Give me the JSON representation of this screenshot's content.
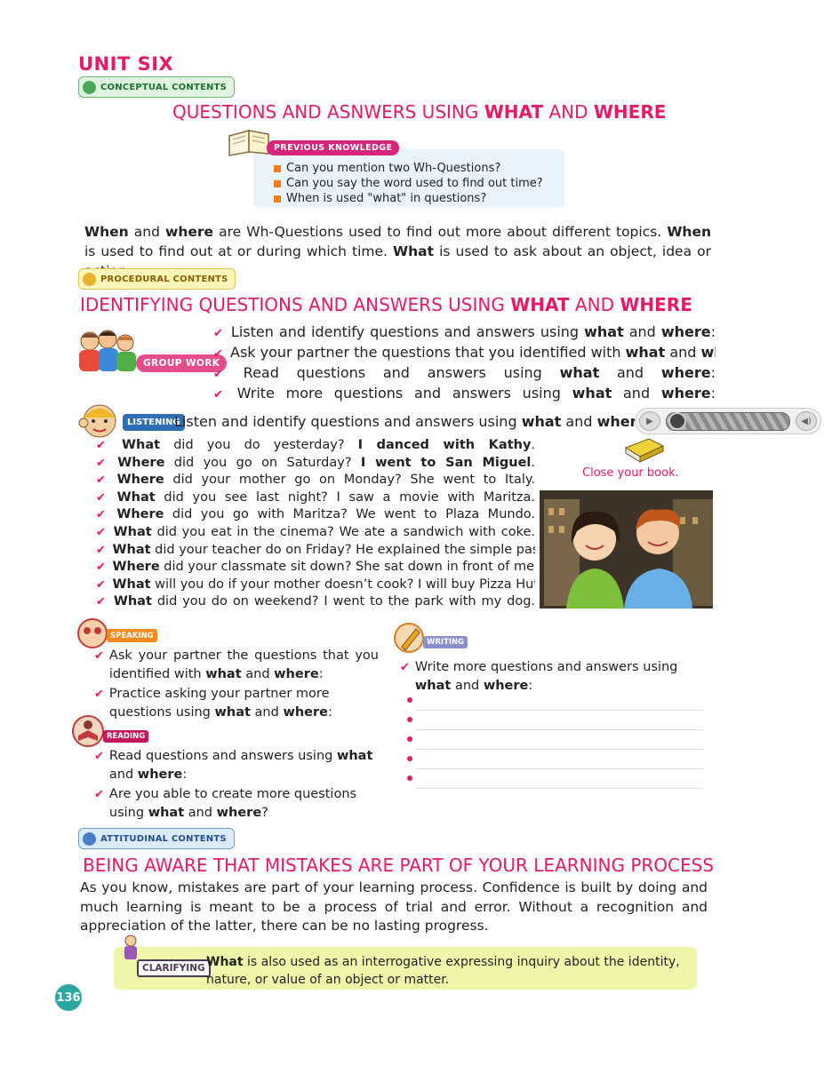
{
  "header": {
    "unit": "UNIT SIX",
    "conceptual_tag": "CONCEPTUAL CONTENTS"
  },
  "title1": {
    "pre": "QUESTIONS AND ASNWERS USING ",
    "w1": "WHAT",
    "mid": " AND ",
    "w2": "WHERE"
  },
  "prev_knowledge": {
    "label": "PREVIOUS KNOWLEDGE",
    "items": [
      "Can you mention two Wh-Questions?",
      "Can you say the word used to find out time?",
      "When is used \"what\" in questions?"
    ]
  },
  "intro": {
    "w_when": "When",
    "t1": " and ",
    "w_where": "where",
    "t2": " are Wh-Questions used to find out more about different topics. ",
    "w_when2": "When",
    "t3": " is used to find out at or during which time. ",
    "w_what": "What",
    "t4": " is used to ask about an object, idea or action."
  },
  "procedural_tag": "PROCEDURAL CONTENTS",
  "title2": {
    "pre": "IDENTIFYING QUESTIONS AND ANSWERS USING ",
    "w1": "WHAT",
    "mid": " AND ",
    "w2": "WHERE"
  },
  "group_work": {
    "label": "GROUP WORK",
    "items": [
      {
        "text": "Listen and identify questions and answers using ",
        "what": "what",
        "and": " and ",
        "where": "where",
        "end": ":"
      },
      {
        "text": "Ask your partner the questions that you identified with ",
        "what": "what",
        "and": " and ",
        "where": "where",
        "end": ":"
      },
      {
        "text": "Read questions and answers using ",
        "what": "what",
        "and": " and ",
        "where": "where",
        "end": ":"
      },
      {
        "text": "Write more questions and answers using ",
        "what": "what",
        "and": " and ",
        "where": "where",
        "end": ":"
      }
    ]
  },
  "listening": {
    "label": "LISTENING",
    "intro": "Listen and identify questions and answers using ",
    "what": "what",
    "and": " and ",
    "where": "where",
    "end": ":",
    "items": [
      {
        "q": "What",
        "rest": " did you do yesterday? ",
        "ans": "I danced with Kathy",
        "end": "."
      },
      {
        "q": "Where",
        "rest": " did you go on Saturday? ",
        "ans": "I went to San Miguel",
        "end": "."
      },
      {
        "q": "Where",
        "rest": " did your mother go on Monday? She went to Italy.",
        "ans": "",
        "end": ""
      },
      {
        "q": "What",
        "rest": " did you see last night? I saw a movie with Maritza.",
        "ans": "",
        "end": ""
      },
      {
        "q": "Where",
        "rest": " did you go with Maritza? We went to Plaza Mundo.",
        "ans": "",
        "end": ""
      },
      {
        "q": "What",
        "rest": " did you eat in the cinema? We ate a sandwich with coke.",
        "ans": "",
        "end": ""
      },
      {
        "q": "What",
        "rest": " did your teacher do on Friday? He explained the simple past.",
        "ans": "",
        "end": ""
      },
      {
        "q": "Where",
        "rest": " did your classmate sit down? She sat down in front of me.",
        "ans": "",
        "end": ""
      },
      {
        "q": "What",
        "rest": " will you do if your mother doesn’t cook? I will buy Pizza Hut.",
        "ans": "",
        "end": ""
      },
      {
        "q": "What",
        "rest": " did you do on weekend? I went to the park with my dog.",
        "ans": "",
        "end": ""
      }
    ],
    "close_book": "Close your book."
  },
  "speaking": {
    "label": "SPEAKING",
    "items": [
      {
        "t1": "Ask your partner the questions that you identified with ",
        "what": "what",
        "t2": " and ",
        "where": "where",
        "t3": ":"
      },
      {
        "t1": "Practice asking your partner more questions using ",
        "what": "what",
        "t2": " and ",
        "where": "where",
        "t3": ":"
      }
    ]
  },
  "reading": {
    "label": "READING",
    "items": [
      {
        "t1": "Read questions and answers using ",
        "what": "what",
        "t2": " and ",
        "where": "where",
        "t3": ":"
      },
      {
        "t1": "Are you able to create more questions using ",
        "what": "what",
        "t2": " and ",
        "where": "where",
        "t3": "?"
      }
    ]
  },
  "writing": {
    "label": "WRITING",
    "t1": "Write more questions and answers using ",
    "what": "what",
    "t2": " and ",
    "where": "where",
    "t3": ":",
    "lines": 5
  },
  "attitudinal_tag": "ATTITUDINAL CONTENTS",
  "title3": "BEING AWARE THAT MISTAKES ARE PART OF YOUR LEARNING PROCESS",
  "attitude_para": "As you know, mistakes are part of your learning process. Confidence is built by doing and much learning is meant to be a process of trial and error. Without a recognition and appreciation of the latter, there can be no lasting progress.",
  "clarifying": {
    "label": "CLARIFYING",
    "w": "What",
    "text": " is also used as an interrogative expressing inquiry about the identity, nature, or value of an object or matter."
  },
  "page_number": "136",
  "colors": {
    "accent": "#e6196b",
    "teal": "#2ba7a2",
    "orange": "#f07b18"
  }
}
